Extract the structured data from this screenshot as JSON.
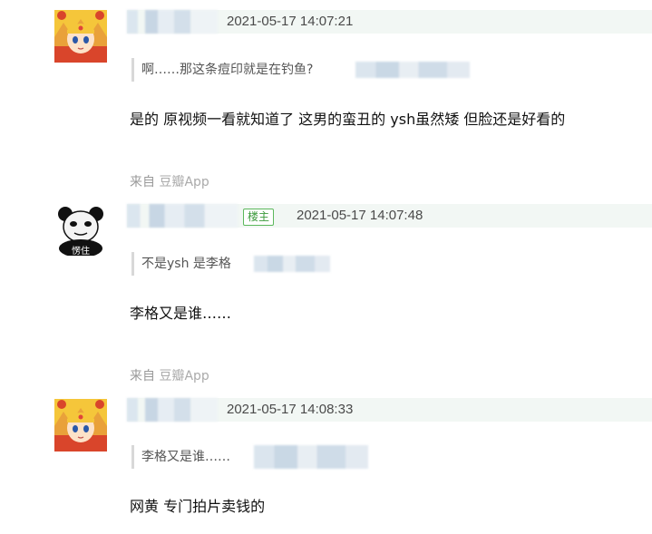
{
  "comments": [
    {
      "time": "2021-05-17 14:07:21",
      "quote": "啊……那这条痘印就是在钓鱼?",
      "content": "是的 原视频一看就知道了 这男的蛮丑的 ysh虽然矮 但脸还是好看的",
      "source_prefix": "来自",
      "source_app": "豆瓣App"
    },
    {
      "badge": "楼主",
      "time": "2021-05-17 14:07:48",
      "quote": "不是ysh 是李格",
      "content": "李格又是谁……",
      "avatar_caption": "愣住",
      "source_prefix": "来自",
      "source_app": "豆瓣App"
    },
    {
      "time": "2021-05-17 14:08:33",
      "quote": "李格又是谁……",
      "content": "网黄 专门拍片卖钱的"
    }
  ],
  "colors": {
    "header_bg": "#f2f7f4",
    "badge_green": "#5cb85c",
    "muted": "#999999"
  }
}
